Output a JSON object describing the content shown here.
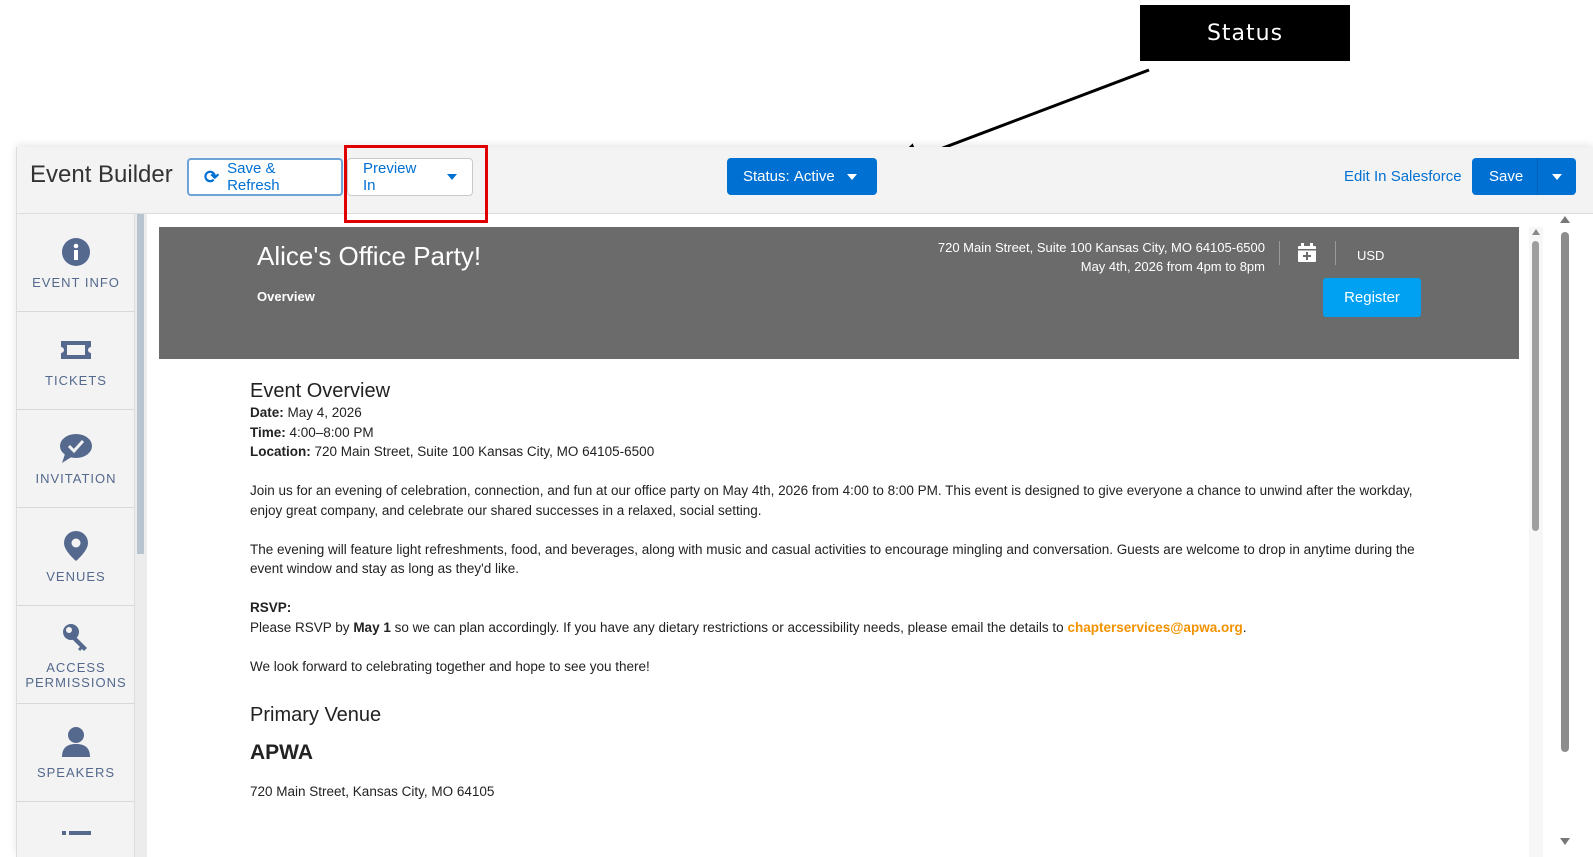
{
  "annotation": {
    "callout_label": "Status"
  },
  "header": {
    "app_title": "Event Builder",
    "save_refresh_label": "Save & Refresh",
    "preview_label": "Preview In",
    "status_label": "Status:",
    "status_value": "Active",
    "edit_link": "Edit In Salesforce",
    "save_label": "Save"
  },
  "sidebar": {
    "items": [
      {
        "label": "EVENT INFO",
        "icon": "info-icon"
      },
      {
        "label": "TICKETS",
        "icon": "ticket-icon"
      },
      {
        "label": "INVITATION",
        "icon": "chat-bubble-icon"
      },
      {
        "label": "VENUES",
        "icon": "map-pin-icon"
      },
      {
        "label": "ACCESS\nPERMISSIONS",
        "icon": "key-icon"
      },
      {
        "label": "SPEAKERS",
        "icon": "person-icon"
      }
    ]
  },
  "event": {
    "title": "Alice's Office Party!",
    "nav_overview": "Overview",
    "address_line": "720 Main Street, Suite 100 Kansas City, MO 64105-6500",
    "date_line": "May 4th, 2026 from 4pm to 8pm",
    "currency": "USD",
    "register_label": "Register"
  },
  "overview": {
    "heading": "Event Overview",
    "date_label": "Date:",
    "date_value": " May 4, 2026",
    "time_label": "Time:",
    "time_value": " 4:00–8:00 PM",
    "location_label": "Location:",
    "location_value": " 720 Main Street, Suite 100 Kansas City, MO 64105-6500",
    "para1": "Join us for an evening of celebration, connection, and fun at our office party on May 4th, 2026 from 4:00 to 8:00 PM. This event is designed to give everyone a chance to unwind after the workday, enjoy great company, and celebrate our shared successes in a relaxed, social setting.",
    "para2": "The evening will feature light refreshments, food, and beverages, along with music and casual activities to encourage mingling and conversation. Guests are welcome to drop in anytime during the event window and stay as long as they'd like.",
    "rsvp_label": "RSVP:",
    "rsvp_pre": "Please RSVP by ",
    "rsvp_date": "May 1",
    "rsvp_mid": " so we can plan accordingly. If you have any dietary restrictions or accessibility needs, please email the details to ",
    "rsvp_email": "chapterservices@apwa.org",
    "rsvp_end": ".",
    "closing": "We look forward to celebrating together and hope to see you there!"
  },
  "venue": {
    "heading": "Primary Venue",
    "name": "APWA",
    "address": "720 Main Street, Kansas City, MO 64105"
  }
}
